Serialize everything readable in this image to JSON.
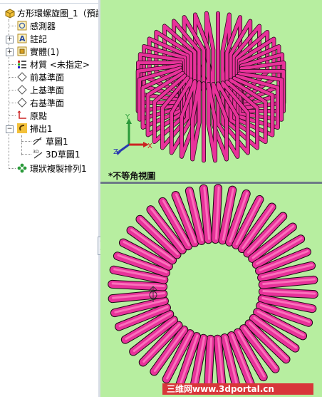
{
  "tree": {
    "root_label": "方形環螺旋圈_1（預設",
    "items": [
      {
        "label": "感測器"
      },
      {
        "label": "註記"
      },
      {
        "label": "實體(1)"
      },
      {
        "label": "材質 <未指定>"
      },
      {
        "label": "前基準面"
      },
      {
        "label": "上基準面"
      },
      {
        "label": "右基準面"
      },
      {
        "label": "原點"
      },
      {
        "label": "掃出1"
      },
      {
        "label": "草圖1"
      },
      {
        "label": "3D草圖1"
      },
      {
        "label": "環狀複製排列1"
      }
    ],
    "expanders": [
      "+",
      "+",
      "+",
      "−"
    ]
  },
  "view": {
    "label": "*不等角視圖",
    "triad": {
      "x": "X",
      "y": "Y",
      "z": "Z"
    }
  },
  "watermark": "三维网www.3dportal.cn",
  "colors": {
    "viewport_bg": "#b7eea0",
    "coil": "#e8329a",
    "coil_highlight": "#ff86c6",
    "coil_edge": "#1c0a13",
    "watermark_bg": "#d8363a"
  }
}
